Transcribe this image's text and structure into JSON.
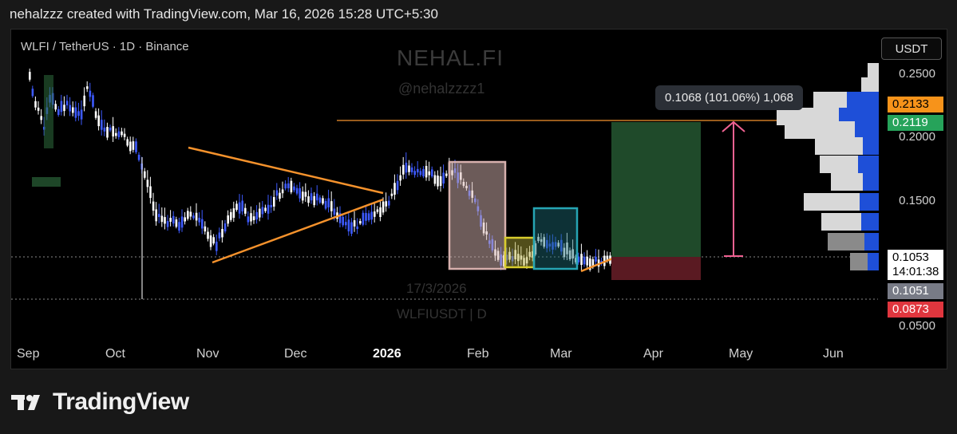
{
  "caption": "nehalzzz created with TradingView.com, Mar 16, 2026 15:28 UTC+5:30",
  "chart": {
    "symbol_title": "WLFI / TetherUS · 1D · Binance",
    "watermark": {
      "name": "NEHAL.FI",
      "handle": "@nehalzzzz1",
      "date": "17/3/2026",
      "pair": "WLFIUSDT | D"
    },
    "measure_tooltip": "0.1068 (101.06%) 1,068",
    "currency": "USDT",
    "price_ticks": [
      "0.2500",
      "0.2000",
      "0.1500",
      "0.0500"
    ],
    "price_pills": [
      {
        "label": "0.2133",
        "color": "#f7931a",
        "text_color": "#000000"
      },
      {
        "label": "0.2119",
        "color": "#26a35a",
        "text_color": "#ffffff"
      },
      {
        "label": "0.1051",
        "color": "#787b86",
        "text_color": "#ffffff"
      },
      {
        "label": "0.0873",
        "color": "#e0363e",
        "text_color": "#ffffff"
      }
    ],
    "last_price": "0.1053",
    "countdown": "14:01:38",
    "time_labels": [
      {
        "label": "Sep",
        "bold": false
      },
      {
        "label": "Oct",
        "bold": false
      },
      {
        "label": "Nov",
        "bold": false
      },
      {
        "label": "Dec",
        "bold": false
      },
      {
        "label": "2026",
        "bold": true
      },
      {
        "label": "Feb",
        "bold": false
      },
      {
        "label": "Mar",
        "bold": false
      },
      {
        "label": "Apr",
        "bold": false
      },
      {
        "label": "May",
        "bold": false
      },
      {
        "label": "Jun",
        "bold": false
      }
    ],
    "colors": {
      "candle_up": "#ffffff",
      "candle_down": "#3d5afe",
      "trendline": "#f5922c",
      "target_line": "#f5922c",
      "profit_zone": "#1f4a2a",
      "loss_zone": "#5a1a22",
      "measure_arrow": "#f06292"
    }
  },
  "brand": {
    "name": "TradingView"
  }
}
